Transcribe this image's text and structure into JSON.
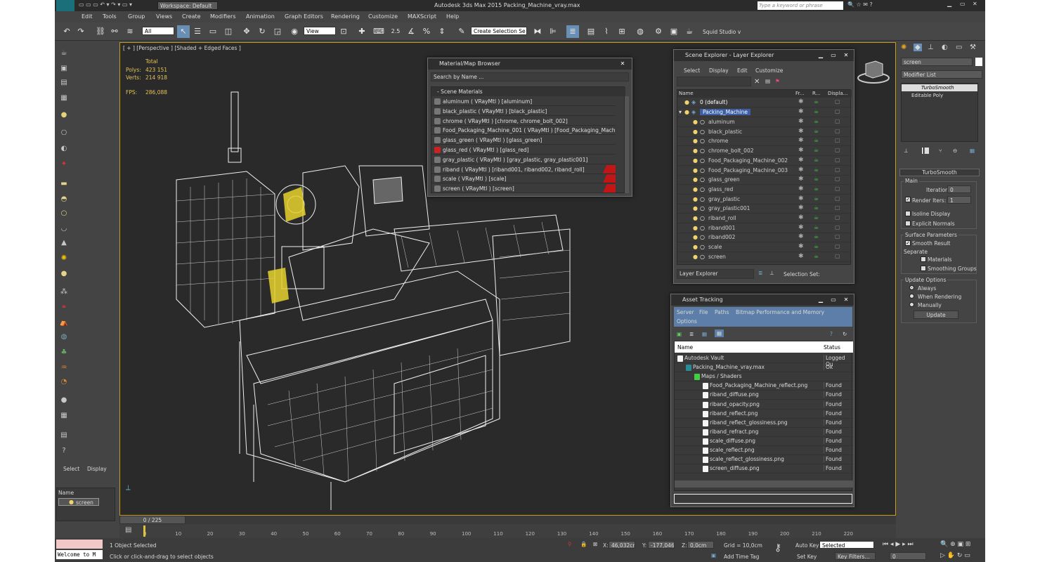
{
  "titlebar": {
    "workspace": "Workspace: Default",
    "title": "Autodesk 3ds Max 2015     Packing_Machine_vray.max",
    "search_placeholder": "Type a keyword or phrase"
  },
  "menu": [
    "Edit",
    "Tools",
    "Group",
    "Views",
    "Create",
    "Modifiers",
    "Animation",
    "Graph Editors",
    "Rendering",
    "Customize",
    "MAXScript",
    "Help"
  ],
  "toolbar": {
    "filter": "All",
    "view": "View",
    "selection_set": "Create Selection Se",
    "squid": "Squid Studio v",
    "snap_value": "2.5"
  },
  "viewport": {
    "label": "[ + ] [Perspective ] [Shaded + Edged Faces ]",
    "stats": {
      "total": "Total",
      "polys_label": "Polys:",
      "polys": "423 151",
      "verts_label": "Verts:",
      "verts": "214 918",
      "fps_label": "FPS:",
      "fps": "286,088"
    }
  },
  "material_browser": {
    "title": "Material/Map Browser",
    "search": "Search by Name ...",
    "section": "- Scene Materials",
    "items": [
      "aluminum  ( VRayMtl ) [aluminum]",
      "black_plastic  ( VRayMtl ) [black_plastic]",
      "chrome  ( VRayMtl ) [chrome, chrome_bolt_002]",
      "Food_Packaging_Machine_001  ( VRayMtl ) [Food_Packaging_Mach...",
      "glass_green  ( VRayMtl ) [glass_green]",
      "glass_red  ( VRayMtl ) [glass_red]",
      "gray_plastic  ( VRayMtl ) [gray_plastic, gray_plastic001]",
      "riband  ( VRayMtl ) [riband001, riband002, riband_roll]",
      "scale  ( VRayMtl ) [scale]",
      "screen  ( VRayMtl ) [screen]"
    ]
  },
  "scene_explorer": {
    "title": "Scene Explorer - Layer Explorer",
    "menu": [
      "Select",
      "Display",
      "Edit",
      "Customize"
    ],
    "columns": [
      "Name",
      "Fr...",
      "R...",
      "Displa..."
    ],
    "layers": [
      "0 (default)",
      "Packing_Machine"
    ],
    "objects": [
      "aluminum",
      "black_plastic",
      "chrome",
      "chrome_bolt_002",
      "Food_Packaging_Machine_002",
      "Food_Packaging_Machine_003",
      "glass_green",
      "glass_red",
      "gray_plastic",
      "gray_plastic001",
      "riband_roll",
      "riband001",
      "riband002",
      "scale",
      "screen"
    ],
    "footer_dropdown": "Layer Explorer",
    "selection_set": "Selection Set:"
  },
  "asset_tracking": {
    "title": "Asset Tracking",
    "menu": [
      "Server",
      "File",
      "Paths",
      "Bitmap Performance and Memory"
    ],
    "menu2": "Options",
    "columns": [
      "Name",
      "Status"
    ],
    "rows": [
      {
        "name": "Autodesk Vault",
        "status": "Logged Ou"
      },
      {
        "name": "Packing_Machine_vray.max",
        "status": "Ok"
      },
      {
        "name": "Maps / Shaders",
        "status": ""
      },
      {
        "name": "Food_Packaging_Machine_reflect.png",
        "status": "Found"
      },
      {
        "name": "riband_diffuse.png",
        "status": "Found"
      },
      {
        "name": "riband_opacity.png",
        "status": "Found"
      },
      {
        "name": "riband_reflect.png",
        "status": "Found"
      },
      {
        "name": "riband_reflect_glossiness.png",
        "status": "Found"
      },
      {
        "name": "riband_refract.png",
        "status": "Found"
      },
      {
        "name": "scale_diffuse.png",
        "status": "Found"
      },
      {
        "name": "scale_reflect.png",
        "status": "Found"
      },
      {
        "name": "scale_reflect_glossiness.png",
        "status": "Found"
      },
      {
        "name": "screen_diffuse.png",
        "status": "Found"
      }
    ]
  },
  "command_panel": {
    "object_name": "screen",
    "modifier_list": "Modifier List",
    "stack": [
      "TurboSmooth",
      "Editable Poly"
    ],
    "rollout": "TurboSmooth",
    "main": "Main",
    "iterations_label": "Iterations:",
    "iterations": "0",
    "render_iters_label": "Render Iters:",
    "render_iters": "1",
    "isoline": "Isoline Display",
    "explicit": "Explicit Normals",
    "surface": "Surface Parameters",
    "smooth": "Smooth Result",
    "separate": "Separate",
    "materials": "Materials",
    "smoothing": "Smoothing Groups",
    "update_options": "Update Options",
    "always": "Always",
    "when_rendering": "When Rendering",
    "manually": "Manually",
    "update": "Update"
  },
  "left_panel": {
    "tabs": [
      "Select",
      "Display"
    ],
    "name_header": "Name",
    "item": "screen"
  },
  "timeline": {
    "frame": "0 / 225",
    "ticks": [
      "0",
      "10",
      "20",
      "30",
      "40",
      "50",
      "60",
      "70",
      "80",
      "90",
      "100",
      "110",
      "120",
      "130",
      "140",
      "150",
      "160",
      "170",
      "180",
      "190",
      "200",
      "210",
      "220"
    ]
  },
  "status": {
    "script": "Welcome to M",
    "selected": "1 Object Selected",
    "hint": "Click or click-and-drag to select objects",
    "x_label": "X:",
    "x": "46,032cm",
    "y_label": "Y:",
    "y": "-177,046cm",
    "z_label": "Z:",
    "z": "0,0cm",
    "grid": "Grid = 10,0cm",
    "add_time_tag": "Add Time Tag",
    "auto_key": "Auto Key",
    "set_key": "Set Key",
    "key_mode": "Selected",
    "key_filters": "Key Filters...",
    "frame_field": "0"
  }
}
